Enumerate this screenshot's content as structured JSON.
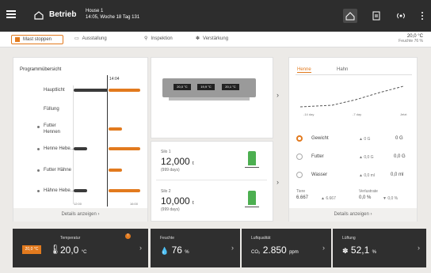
{
  "topbar": {
    "title": "Betrieb",
    "house_name": "House 1",
    "house_time": "14:05, Woche 18 Tag 131"
  },
  "subbar": {
    "stop_button": "Mast stoppen",
    "items": [
      "Ausstallung",
      "Inspektion",
      "Verstärkung"
    ],
    "temp": "20,0 °C",
    "humidity": "Feuchte 76 %"
  },
  "programm": {
    "title": "Programmübersicht",
    "time_marker": "14:04",
    "rows": [
      "Hauptlicht",
      "Füllung",
      "Futter Hennen",
      "Henne Hebe...",
      "Futter Hähne",
      "Hähne Hebe..."
    ],
    "axis_left": "12:00",
    "axis_right": "16:00",
    "details": "Details anzeigen"
  },
  "scale": {
    "readouts": [
      "20,0 °C",
      "19,9 °C",
      "20,1 °C"
    ]
  },
  "silos": [
    {
      "name": "Silo 1",
      "value": "12,000",
      "unit": "t",
      "sub": "(999 days)"
    },
    {
      "name": "Silo 2",
      "value": "10,000",
      "unit": "t",
      "sub": "(999 days)"
    }
  ],
  "weights": {
    "tabs": [
      "Henne",
      "Hahn"
    ],
    "chart_axis": [
      "-14 day",
      "-7 day",
      "Jetzt"
    ],
    "rows": [
      {
        "label": "Gewicht",
        "delta": "▲ 0 G",
        "value": "0 G"
      },
      {
        "label": "Futter",
        "delta": "▲ 0,0 G",
        "value": "0,0 G"
      },
      {
        "label": "Wasser",
        "delta": "▲ 0,0 ml",
        "value": "0,0 ml"
      }
    ],
    "uniformity_label": "Tiere",
    "uniformity_val": "6.667",
    "uniformity_sub": "▲ 6.667",
    "mortality_label": "Verlustrate",
    "mortality_val": "0,0 %",
    "mortality_sub": "▼ 0,0 %",
    "details": "Details anzeigen"
  },
  "tiles": [
    {
      "label": "Temperatur",
      "value": "20,0",
      "unit": "°C",
      "badge": "20,0 °C"
    },
    {
      "label": "Feuchte",
      "value": "76",
      "unit": "%"
    },
    {
      "label": "Luftqualität",
      "prefix": "CO₂",
      "value": "2.850",
      "unit": "ppm"
    },
    {
      "label": "Lüftung",
      "value": "52,1",
      "unit": "%"
    }
  ],
  "colors": {
    "accent": "#e27a1e",
    "dark": "#2d2d2d",
    "green": "#4caf50"
  }
}
